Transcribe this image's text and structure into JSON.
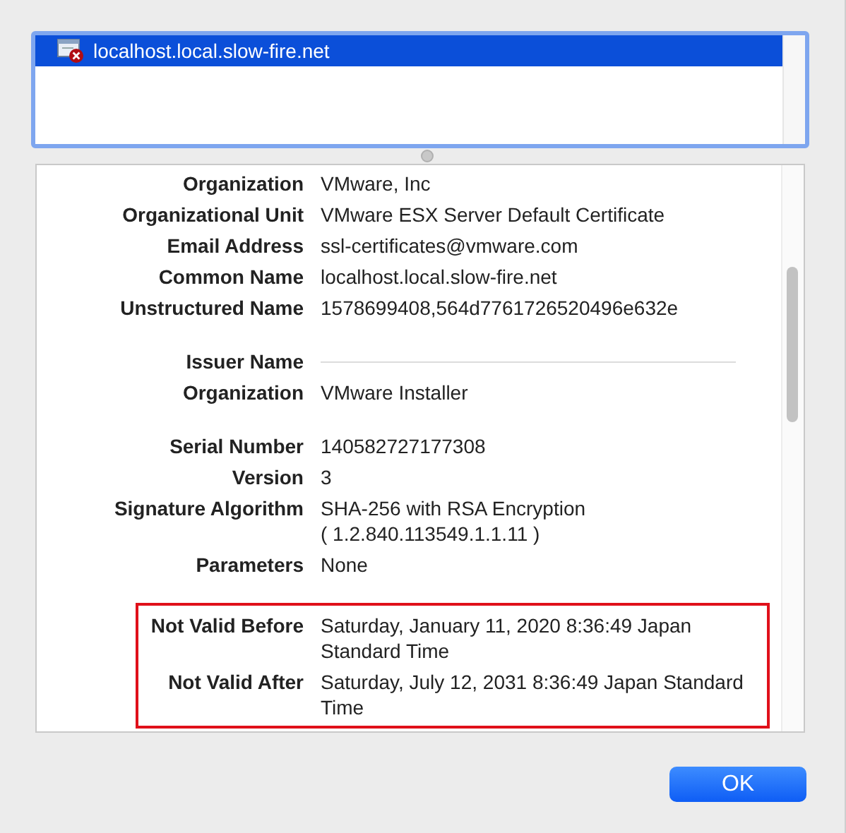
{
  "certificates": [
    {
      "name": "localhost.local.slow-fire.net",
      "selected": true
    }
  ],
  "details": {
    "groups": [
      {
        "highlighted": false,
        "rows": [
          {
            "kind": "field",
            "label": "Organization",
            "value": "VMware, Inc"
          },
          {
            "kind": "field",
            "label": "Organizational Unit",
            "value": "VMware ESX Server Default Certificate"
          },
          {
            "kind": "field",
            "label": "Email Address",
            "value": "ssl-certificates@vmware.com"
          },
          {
            "kind": "field",
            "label": "Common Name",
            "value": "localhost.local.slow-fire.net"
          },
          {
            "kind": "field",
            "label": "Unstructured Name",
            "value": "1578699408,564d7761726520496e632e"
          }
        ]
      },
      {
        "highlighted": false,
        "rows": [
          {
            "kind": "heading",
            "label": "Issuer Name"
          },
          {
            "kind": "field",
            "label": "Organization",
            "value": "VMware Installer"
          }
        ]
      },
      {
        "highlighted": false,
        "rows": [
          {
            "kind": "field",
            "label": "Serial Number",
            "value": "140582727177308"
          },
          {
            "kind": "field",
            "label": "Version",
            "value": "3"
          },
          {
            "kind": "field",
            "label": "Signature Algorithm",
            "value": "SHA-256 with RSA Encryption\n( 1.2.840.113549.1.1.11 )"
          },
          {
            "kind": "field",
            "label": "Parameters",
            "value": "None"
          }
        ]
      },
      {
        "highlighted": true,
        "rows": [
          {
            "kind": "field",
            "label": "Not Valid Before",
            "value": "Saturday, January 11, 2020 8:36:49 Japan Standard Time"
          },
          {
            "kind": "field",
            "label": "Not Valid After",
            "value": "Saturday, July 12, 2031 8:36:49 Japan Standard Time"
          }
        ]
      }
    ]
  },
  "buttons": [
    {
      "label": "OK"
    }
  ]
}
